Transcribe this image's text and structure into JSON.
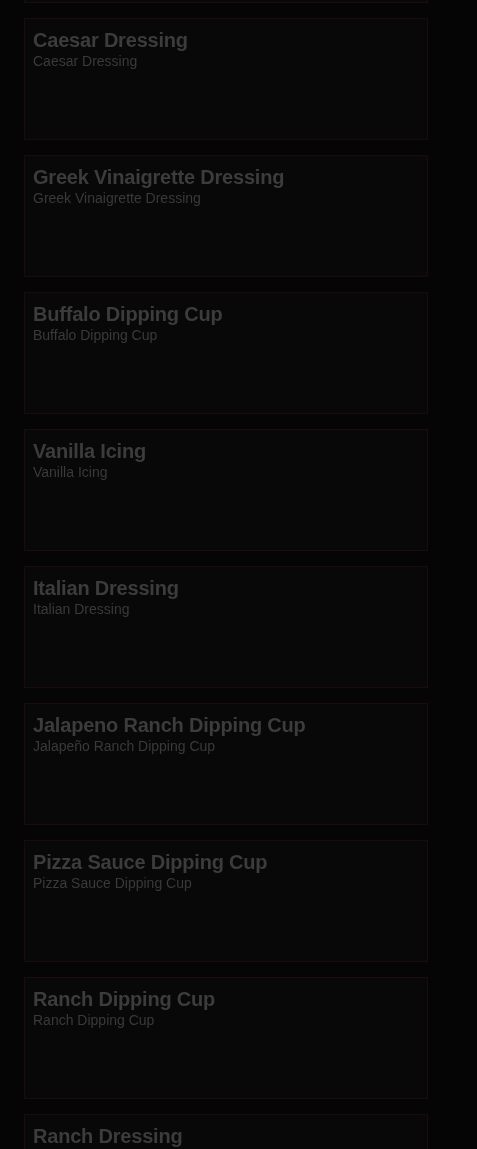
{
  "items": [
    {
      "title": "Caesar Dressing",
      "subtitle": "Caesar Dressing"
    },
    {
      "title": "Greek Vinaigrette Dressing",
      "subtitle": "Greek Vinaigrette Dressing"
    },
    {
      "title": "Buffalo Dipping Cup",
      "subtitle": "Buffalo Dipping Cup"
    },
    {
      "title": "Vanilla Icing",
      "subtitle": "Vanilla Icing"
    },
    {
      "title": "Italian Dressing",
      "subtitle": "Italian Dressing"
    },
    {
      "title": "Jalapeno Ranch Dipping Cup",
      "subtitle": "Jalapeño Ranch Dipping Cup"
    },
    {
      "title": "Pizza Sauce Dipping Cup",
      "subtitle": "Pizza Sauce Dipping Cup"
    },
    {
      "title": "Ranch Dipping Cup",
      "subtitle": "Ranch Dipping Cup"
    },
    {
      "title": "Ranch Dressing"
    }
  ]
}
